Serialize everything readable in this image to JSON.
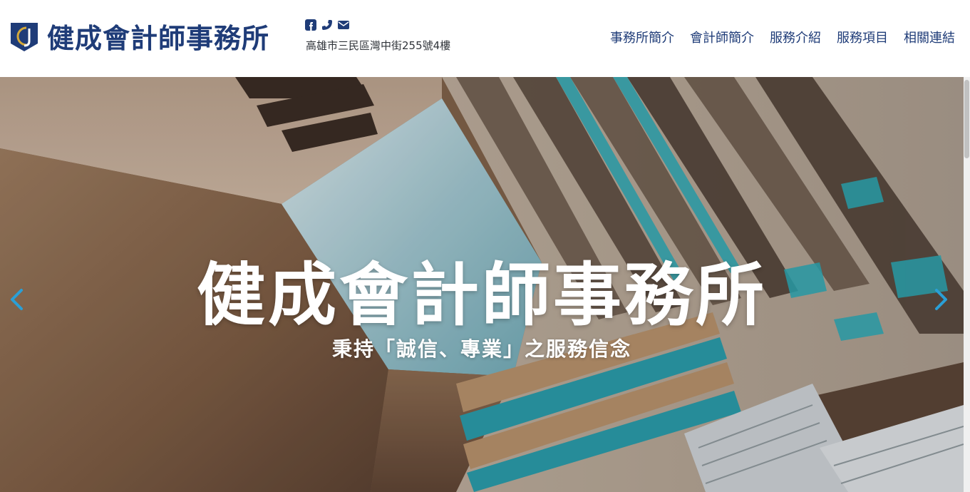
{
  "header": {
    "site_name": "健成會計師事務所",
    "address": "高雄市三民區灣中街255號4樓",
    "contact_icons": [
      "facebook-icon",
      "phone-icon",
      "envelope-icon"
    ]
  },
  "nav": {
    "items": [
      {
        "label": "事務所簡介"
      },
      {
        "label": "會計師簡介"
      },
      {
        "label": "服務介紹"
      },
      {
        "label": "服務項目"
      },
      {
        "label": "相關連結"
      }
    ]
  },
  "hero": {
    "title": "健成會計師事務所",
    "subtitle": "秉持「誠信、專業」之服務信念",
    "prev_icon": "chevron-left-icon",
    "next_icon": "chevron-right-icon"
  },
  "colors": {
    "brand_navy": "#1f3c78",
    "logo_gold": "#d4a93a",
    "arrow_blue": "#2a9fd6"
  }
}
